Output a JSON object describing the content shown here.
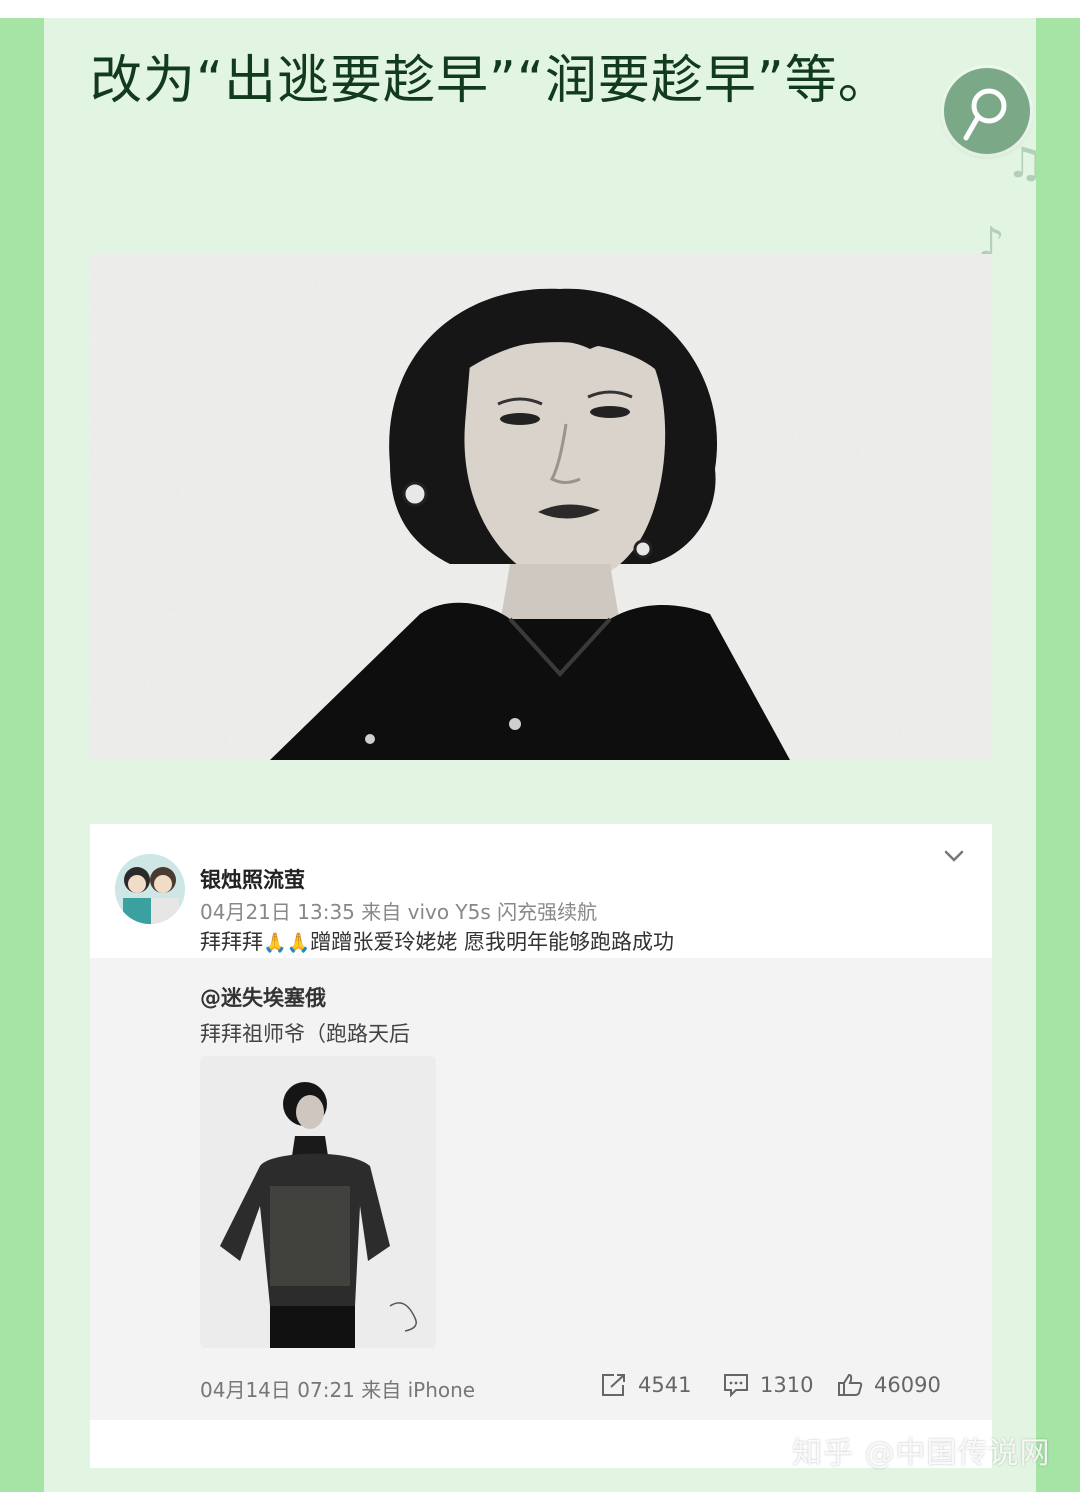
{
  "article": {
    "headline": "改为“出逃要趁早”“润要趁早”等。"
  },
  "icons": {
    "music_button": "music-disc-icon",
    "notes": "music-note-icon"
  },
  "weibo_post": {
    "username": "银烛照流萤",
    "meta": "04月21日 13:35  来自 vivo Y5s 闪充强续航",
    "text_before": "拜拜拜",
    "emoji": "🙏🙏",
    "text_after": "蹭蹭张爱玲姥姥 愿我明年能够跑路成功",
    "repost": {
      "username": "@迷失埃塞俄",
      "text": "拜拜祖师爷（跑路天后",
      "meta": "04月14日 07:21 来自 iPhone",
      "stats": {
        "reposts": "4541",
        "comments": "1310",
        "likes": "46090"
      }
    }
  },
  "watermark": "知乎 @中国传说网",
  "colors": {
    "outer_background": "#a6e4a6",
    "panel_background": "#e2f5e2",
    "headline_text": "#123a1c",
    "music_button": "#7ba886"
  }
}
